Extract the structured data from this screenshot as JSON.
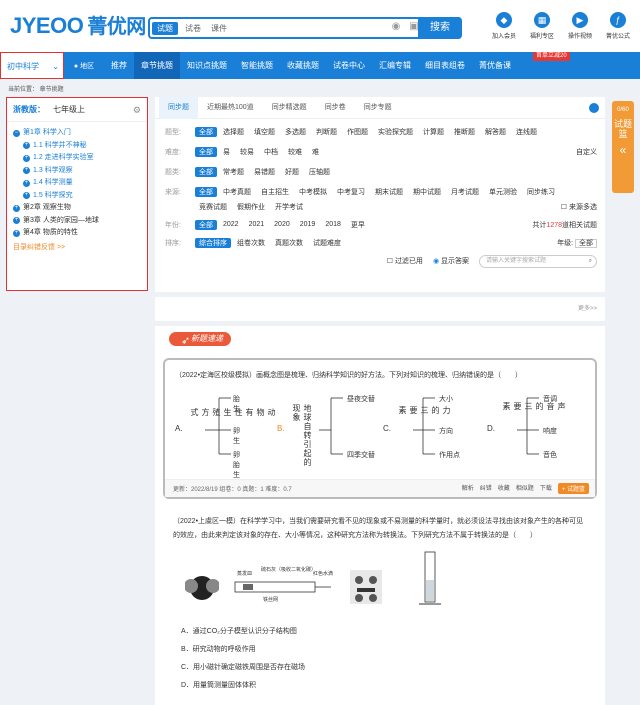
{
  "header": {
    "logo_main": "JYEOO",
    "logo_cn": "菁优网",
    "search_tabs": [
      "试题",
      "试卷",
      "课件"
    ],
    "search_button": "搜索",
    "tools": [
      "加入会员",
      "福利专区",
      "操作视频",
      "菁优公式"
    ]
  },
  "nav": {
    "subject": "初中科学",
    "region": "地区",
    "items": [
      "推荐",
      "章节挑题",
      "知识点挑题",
      "智能挑题",
      "收藏挑题",
      "试卷中心",
      "汇编专辑",
      "细目表组卷",
      "菁优备课"
    ],
    "promo": "首单立减20"
  },
  "breadcrumb": "当前位置：  章节挑题",
  "sidebar": {
    "version_label": "浙教版：",
    "grade": "七年级上",
    "chapters": [
      {
        "label": "第1章  科学入门",
        "sections": [
          "1.1 科学并不神秘",
          "1.2 走进科学实验室",
          "1.3 科学观察",
          "1.4 科学测量",
          "1.5 科学探究"
        ]
      },
      {
        "label": "第2章  观察生物",
        "sections": []
      },
      {
        "label": "第3章  人类的家园—地球",
        "sections": []
      },
      {
        "label": "第4章  物质的特性",
        "sections": []
      }
    ],
    "feedback": "目录纠错反馈 >>"
  },
  "tabs": [
    "同步题",
    "近期最热100道",
    "同步精选题",
    "同步卷",
    "同步专题"
  ],
  "filters": {
    "type_label": "题型:",
    "types": [
      "全部",
      "选择题",
      "填空题",
      "多选题",
      "判断题",
      "作图题",
      "实验探究题",
      "计算题",
      "推断题",
      "解答题",
      "连线题"
    ],
    "diff_label": "难度:",
    "diffs": [
      "全部",
      "易",
      "较易",
      "中档",
      "较难",
      "难"
    ],
    "custom": "自定义",
    "cat_label": "题类:",
    "cats": [
      "全部",
      "常考题",
      "易错题",
      "好题",
      "压轴题"
    ],
    "src_label": "来源:",
    "srcs": [
      "全部",
      "中考真题",
      "自主招生",
      "中考模拟",
      "中考复习",
      "期末试题",
      "期中试题",
      "月考试题",
      "单元测验",
      "同步练习"
    ],
    "srcs2": [
      "竞赛试题",
      "假期作业",
      "开学考试"
    ],
    "src_multi": "来源多选",
    "year_label": "年份:",
    "years": [
      "全部",
      "2022",
      "2021",
      "2020",
      "2019",
      "2018",
      "更早"
    ],
    "total_pre": "共计",
    "total_num": "1278",
    "total_post": "道相关试题",
    "sort_label": "排序:",
    "sorts": [
      "综合排序",
      "组卷次数",
      "真题次数",
      "试题难度"
    ],
    "grade_label": "年级:",
    "grade_val": "全部",
    "filter_used": "过滤已用",
    "show_answer": "显示答案",
    "kw_placeholder": "请输入关键字搜索试题",
    "more": "更多>>"
  },
  "badge": "新题速递",
  "q1": {
    "text": "（2022•定海区校级模拟）画概念图是梳理、归纳科学知识的好方法。下列对知识的梳理、归纳错误的是（　　）",
    "A": {
      "letter": "A.",
      "root": "动物有性生殖方式",
      "leaves": [
        "胎生",
        "卵生",
        "卵胎生"
      ]
    },
    "B": {
      "letter": "B.",
      "root": "地球自转引起的现象",
      "leaves": [
        "昼夜交替",
        "四季交替"
      ]
    },
    "C": {
      "letter": "C.",
      "root": "力的三要素",
      "leaves": [
        "大小",
        "方向",
        "作用点"
      ]
    },
    "D": {
      "letter": "D.",
      "root": "声音的三要素",
      "leaves": [
        "音调",
        "响度",
        "音色"
      ]
    },
    "meta": "更新：2022/8/19   组卷：0   真题：1   难度：0.7",
    "acts": [
      "解析",
      "纠错",
      "收藏",
      "相似题",
      "下载",
      "+ 试题篮"
    ]
  },
  "q2": {
    "text": "（2022•上虞区一模）在科学学习中，当我们需要研究看不见的现象或不易测量的科学量时，就必须设法寻找由该对象产生的各种可见的效应，由此来判定该对象的存在、大小等情况，这种研究方法称为转换法。下列研究方法不属于转换法的是（　　）",
    "fig_labels": [
      "蒸发皿",
      "硫石灰（吸收二氧化碳）",
      "红色水滴",
      "铁丝网"
    ],
    "options": [
      "A．通过CO₂分子模型认识分子结构图",
      "B．研究动物的呼吸作用",
      "C．用小磁针确定磁铁周围是否存在磁场",
      "D．用量筒测量固体体积"
    ]
  },
  "float_panel": {
    "count": "0/60",
    "title": "试题篮",
    "collapse": "«"
  }
}
